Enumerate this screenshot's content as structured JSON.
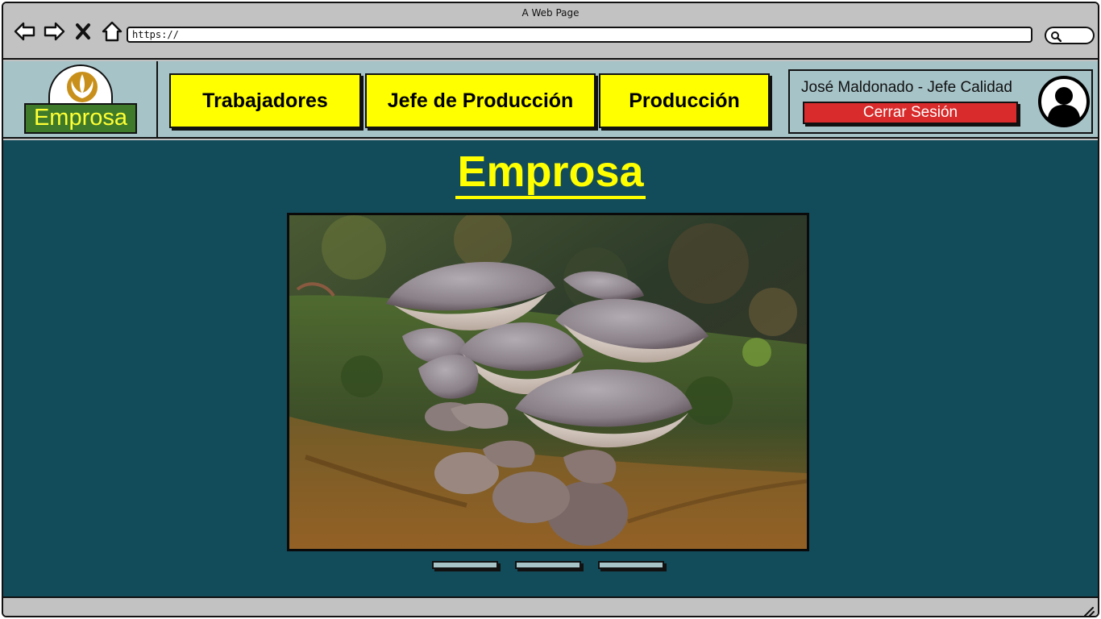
{
  "window": {
    "title": "A Web Page"
  },
  "browser": {
    "url": "https://",
    "icons": [
      "back-arrow-icon",
      "forward-arrow-icon",
      "close-icon",
      "home-icon",
      "search-icon",
      "resize-handle-icon"
    ]
  },
  "header": {
    "logo_text": "Emprosa",
    "logo_icon": "rebel-alliance-emblem-icon",
    "nav": [
      {
        "label": "Trabajadores"
      },
      {
        "label": "Jefe de Producción"
      },
      {
        "label": "Producción"
      }
    ],
    "user": {
      "name": "José Maldonado - Jefe Calidad",
      "logout_label": "Cerrar Sesión",
      "avatar_icon": "user-avatar-icon"
    }
  },
  "main": {
    "title": "Emprosa",
    "carousel": {
      "image_subject": "oyster mushrooms on mossy log",
      "slide_count": 3
    }
  },
  "colors": {
    "chrome": "#c2c2c2",
    "header_bg": "#a6c3c8",
    "main_bg": "#124c5b",
    "accent_yellow": "#ffff00",
    "logout_red": "#d92b2b",
    "logo_green": "#3e7a2a"
  }
}
